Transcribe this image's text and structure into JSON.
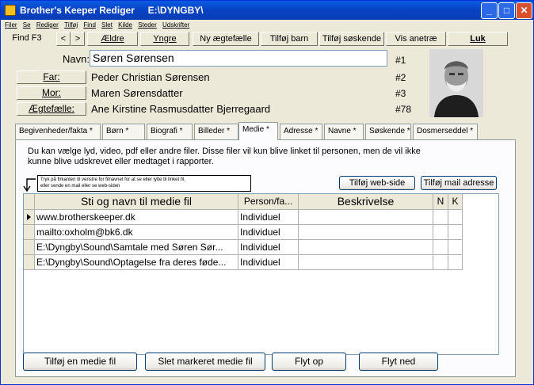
{
  "window": {
    "title": "Brother's Keeper Rediger     E:\\DYNGBY\\",
    "controls": {
      "minimize": "_",
      "maximize": "□",
      "close": "✕"
    }
  },
  "menu": [
    "Filer",
    "Se",
    "Rediger",
    "Tilføj",
    "Find",
    "Slet",
    "Kilde",
    "Steder",
    "Udskrifter"
  ],
  "toolbar": {
    "find": "Find  F3",
    "prev": "<",
    "next": ">",
    "older": "Ældre",
    "younger": "Yngre",
    "new_spouse": "Ny ægtefælle",
    "add_child": "Tilføj barn",
    "add_sibling": "Tilføj søskende",
    "show_ancestors": "Vis anetræ",
    "close": "Luk"
  },
  "person": {
    "name_label": "Navn:",
    "name": "Søren Sørensen",
    "name_id": "#1",
    "father_label": "Far:",
    "father": "Peder Christian Sørensen",
    "father_id": "#2",
    "mother_label": "Mor:",
    "mother": "Maren Sørensdatter",
    "mother_id": "#3",
    "spouse_label": "Ægtefælle:",
    "spouse": "Ane Kirstine Rasmusdatter Bjerregaard",
    "spouse_id": "#78"
  },
  "tabs": [
    {
      "label": "Begivenheder/fakta *"
    },
    {
      "label": "Børn *"
    },
    {
      "label": "Biografi *"
    },
    {
      "label": "Billeder *"
    },
    {
      "label": "Medie *"
    },
    {
      "label": "Adresse *"
    },
    {
      "label": "Navne *"
    },
    {
      "label": "Søskende *"
    },
    {
      "label": "Dosmerseddel  *"
    }
  ],
  "active_tab": "Medie *",
  "media": {
    "info_line1": "Du kan vælge lyd, video, pdf eller andre filer. Disse filer vil kun blive linket til personen, men de vil ikke",
    "info_line2": "kunne blive udskrevet eller medtaget i rapporter.",
    "hint_line1": "Tryk på firkanten til venstre for filnavnet for at se eller lytte til linket fil,",
    "hint_line2": "eller sende en mail eller se web-siden",
    "add_web": "Tilføj web-side",
    "add_mail": "Tilføj mail adresse",
    "columns": [
      "Sti og navn til medie fil",
      "Person/fa...",
      "Beskrivelse",
      "N",
      "K"
    ],
    "rows": [
      {
        "path": "www.brotherskeeper.dk",
        "type": "Individuel",
        "desc": "",
        "n": "",
        "k": ""
      },
      {
        "path": "mailto:oxholm@bk6.dk",
        "type": "Individuel",
        "desc": "",
        "n": "",
        "k": ""
      },
      {
        "path": "E:\\Dyngby\\Sound\\Samtale med Søren Sør...",
        "type": "Individuel",
        "desc": "",
        "n": "",
        "k": ""
      },
      {
        "path": "E:\\Dyngby\\Sound\\Optagelse fra deres føde...",
        "type": "Individuel",
        "desc": "",
        "n": "",
        "k": ""
      }
    ],
    "add_media": "Tilføj en medie fil",
    "delete_media": "Slet markeret medie fil",
    "move_up": "Flyt op",
    "move_down": "Flyt ned"
  }
}
